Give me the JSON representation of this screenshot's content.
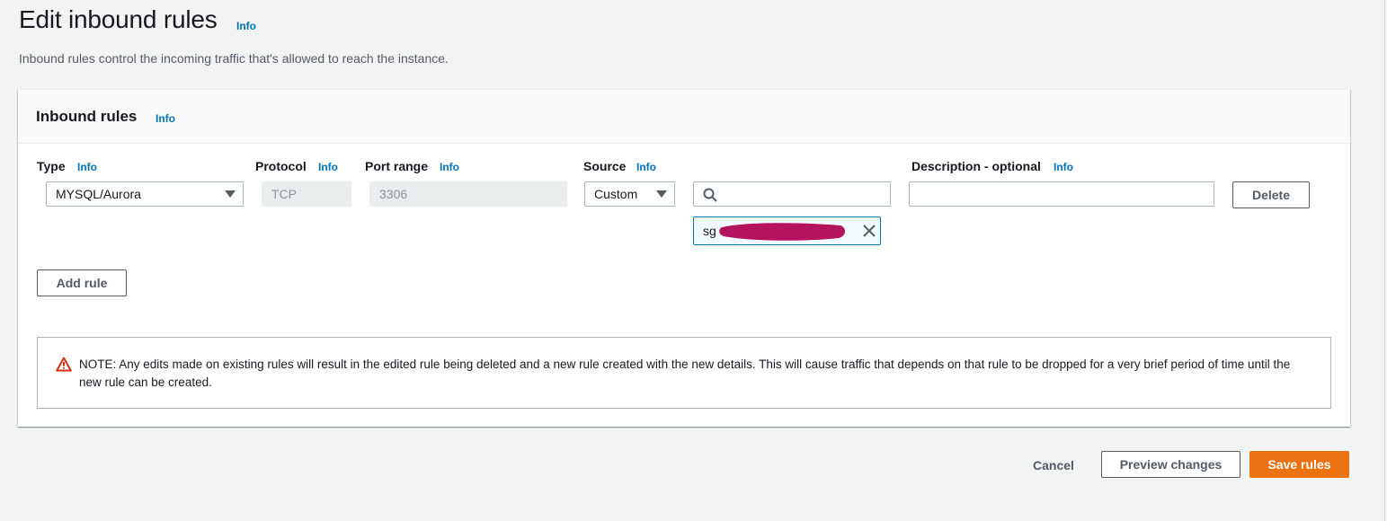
{
  "page": {
    "title": "Edit inbound rules",
    "title_info": "Info",
    "description": "Inbound rules control the incoming traffic that's allowed to reach the instance."
  },
  "panel": {
    "title": "Inbound rules",
    "title_info": "Info"
  },
  "columns": {
    "type": {
      "label": "Type",
      "info": "Info"
    },
    "protocol": {
      "label": "Protocol",
      "info": "Info"
    },
    "port_range": {
      "label": "Port range",
      "info": "Info"
    },
    "source": {
      "label": "Source",
      "info": "Info"
    },
    "description": {
      "label": "Description - optional",
      "info": "Info"
    }
  },
  "rule": {
    "type": "MYSQL/Aurora",
    "protocol": "TCP",
    "port_range": "3306",
    "source_mode": "Custom",
    "source_search": "",
    "source_token": "sg",
    "description": "",
    "delete_label": "Delete"
  },
  "add_rule_label": "Add rule",
  "note": "NOTE: Any edits made on existing rules will result in the edited rule being deleted and a new rule created with the new details. This will cause traffic that depends on that rule to be dropped for a very brief period of time until the new rule can be created.",
  "footer": {
    "cancel": "Cancel",
    "preview": "Preview changes",
    "save": "Save rules"
  },
  "colors": {
    "primary": "#ec7211",
    "link": "#0073bb",
    "warning": "#d13212",
    "redaction": "#b5135f"
  },
  "icons": [
    "chevron-down-icon",
    "search-icon",
    "close-icon",
    "warning-icon"
  ]
}
